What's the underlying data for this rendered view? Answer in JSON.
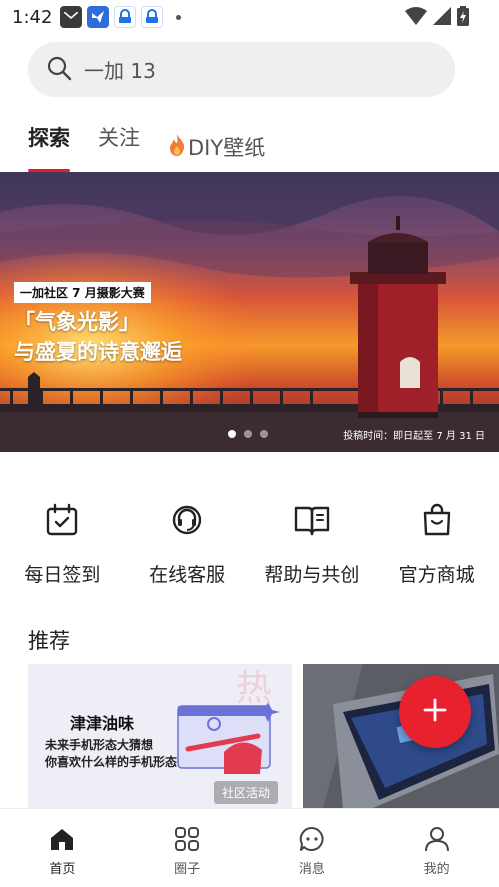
{
  "status_bar": {
    "time": "1:42",
    "app_icons": [
      "mail-icon",
      "bird-app-icon",
      "vpn-icon",
      "vpn-icon"
    ]
  },
  "search": {
    "value": "一加 13"
  },
  "tabs": [
    {
      "label": "探索",
      "active": true
    },
    {
      "label": "关注",
      "active": false
    },
    {
      "label": "DIY壁纸",
      "active": false,
      "icon": "flame-icon"
    }
  ],
  "banner": {
    "tag": "一加社区 7 月摄影大赛",
    "title_line1": "「气象光影」",
    "title_line2": "与盛夏的诗意邂逅",
    "caption": "投稿时间：即日起至 7 月 31 日",
    "slide_count": 3,
    "active_slide": 0
  },
  "quick_actions": [
    {
      "label": "每日签到",
      "icon": "calendar-check-icon"
    },
    {
      "label": "在线客服",
      "icon": "headset-icon"
    },
    {
      "label": "帮助与共创",
      "icon": "open-book-icon"
    },
    {
      "label": "官方商城",
      "icon": "shopping-bag-icon"
    }
  ],
  "recommend": {
    "title": "推荐",
    "card1": {
      "title": "津津油味",
      "line1": "未来手机形态大猜想",
      "line2": "你喜欢什么样的手机形态",
      "badge": "社区活动"
    }
  },
  "bottom_nav": [
    {
      "label": "首页",
      "icon": "home-icon",
      "active": true
    },
    {
      "label": "圈子",
      "icon": "grid-icon",
      "active": false
    },
    {
      "label": "消息",
      "icon": "chat-icon",
      "active": false
    },
    {
      "label": "我的",
      "icon": "person-icon",
      "active": false
    }
  ],
  "colors": {
    "accent": "#e51d2a",
    "fab": "#e8212e"
  }
}
